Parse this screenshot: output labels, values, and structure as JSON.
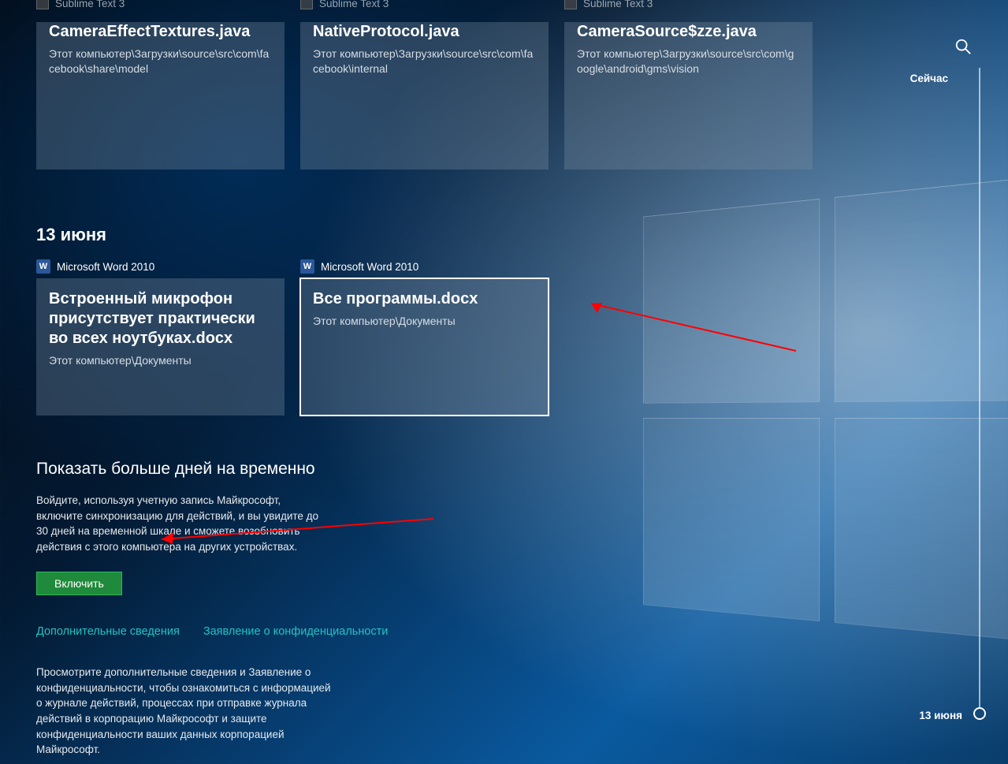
{
  "top_row": [
    {
      "app": "Sublime Text 3",
      "title": "CameraEffectTextures.java",
      "path": "Этот компьютер\\Загрузки\\source\\src\\com\\facebook\\share\\model"
    },
    {
      "app": "Sublime Text 3",
      "title": "NativeProtocol.java",
      "path": "Этот компьютер\\Загрузки\\source\\src\\com\\facebook\\internal"
    },
    {
      "app": "Sublime Text 3",
      "title": "CameraSource$zze.java",
      "path": "Этот компьютер\\Загрузки\\source\\src\\com\\google\\android\\gms\\vision"
    }
  ],
  "section_date": "13 июня",
  "mid_row": [
    {
      "app": "Microsoft Word 2010",
      "title": "Встроенный микрофон присутствует практически во всех ноутбуках.docx",
      "path": "Этот компьютер\\Документы",
      "selected": false
    },
    {
      "app": "Microsoft Word 2010",
      "title": "Все программы.docx",
      "path": "Этот компьютер\\Документы",
      "selected": true
    }
  ],
  "promo": {
    "heading": "Показать больше дней на временно",
    "body": "Войдите, используя учетную запись Майкрософт, включите синхронизацию для действий, и вы увидите до 30 дней на временной шкале и сможете возобновить действия с этого компьютера на других устройствах.",
    "button": "Включить"
  },
  "links": {
    "more": "Дополнительные сведения",
    "privacy": "Заявление о конфиденциальности"
  },
  "fineprint": "Просмотрите дополнительные сведения и Заявление о конфиденциальности, чтобы ознакомиться с информацией о журнале действий, процессах при отправке журнала действий в корпорацию Майкрософт и защите конфиденциальности ваших данных корпорацией Майкрософт.",
  "rail": {
    "top": "Сейчас",
    "bottom": "13 июня"
  }
}
